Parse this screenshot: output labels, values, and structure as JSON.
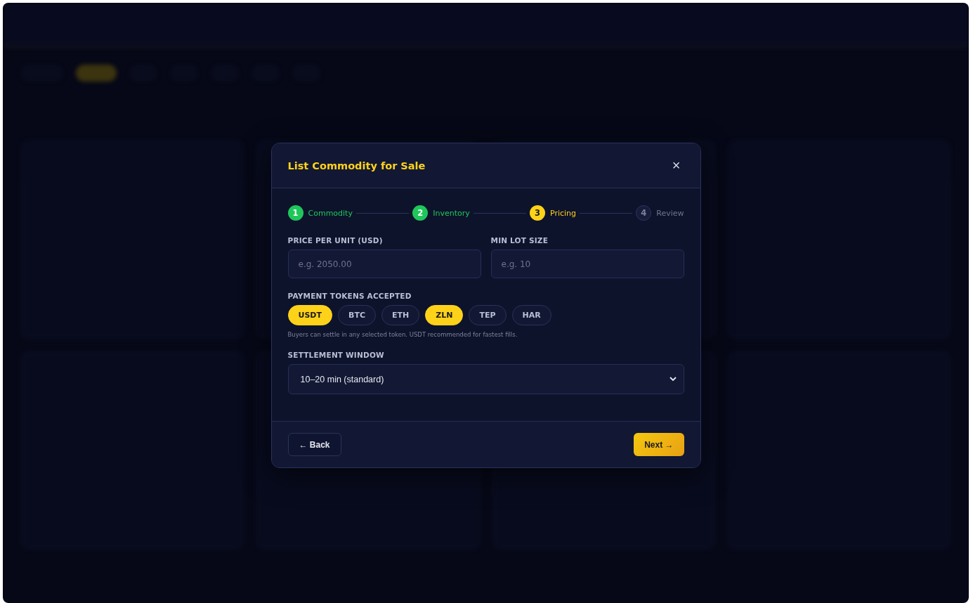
{
  "dialog": {
    "title": "List Commodity for Sale",
    "close": "×",
    "steps": [
      {
        "number": "1",
        "label": "Commodity",
        "completed": true,
        "selected": false
      },
      {
        "number": "2",
        "label": "Inventory",
        "completed": true,
        "selected": false
      },
      {
        "number": "3",
        "label": "Pricing",
        "completed": false,
        "selected": true
      },
      {
        "number": "4",
        "label": "Review",
        "completed": false,
        "selected": false
      }
    ],
    "fields": [
      {
        "label": "PRICE PER UNIT (USD)",
        "placeholder": "e.g. 2050.00"
      },
      {
        "label": "MIN LOT SIZE",
        "placeholder": "e.g. 10"
      }
    ],
    "tokens_label": "PAYMENT TOKENS ACCEPTED",
    "tokens": [
      {
        "label": "USDT",
        "selected": true
      },
      {
        "label": "BTC",
        "selected": false
      },
      {
        "label": "ETH",
        "selected": false
      },
      {
        "label": "ZLN",
        "selected": true
      },
      {
        "label": "TEP",
        "selected": false
      },
      {
        "label": "HAR",
        "selected": false
      }
    ],
    "tokens_hint": "Buyers can settle in any selected token. USDT recommended for fastest fills.",
    "settlement_label": "SETTLEMENT WINDOW",
    "settlement_value": "10–20 min (standard)",
    "back": "← Back",
    "next": "Next →"
  }
}
